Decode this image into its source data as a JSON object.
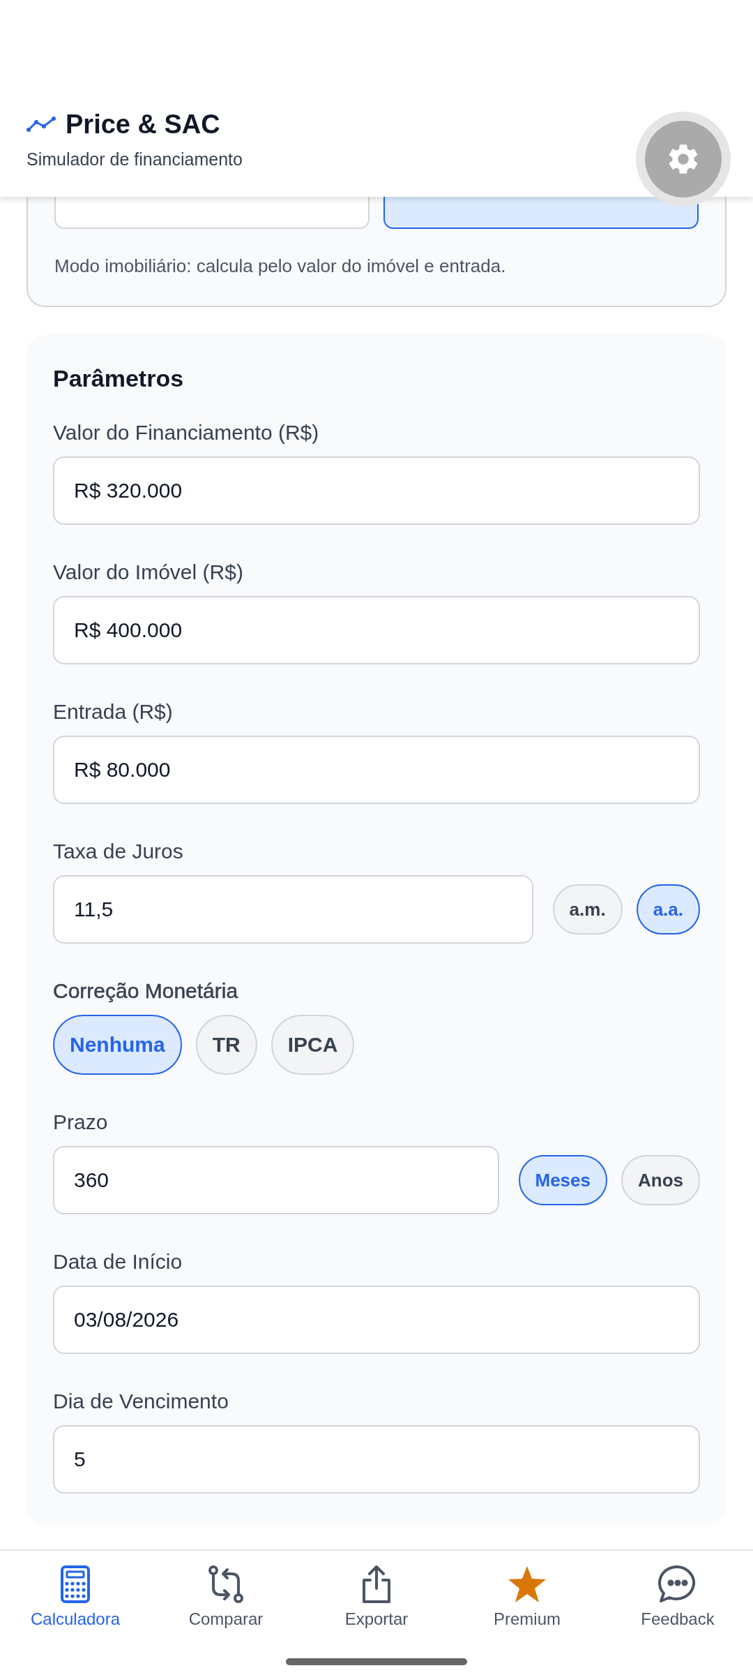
{
  "header": {
    "title": "Price & SAC",
    "subtitle": "Simulador de financiamento"
  },
  "mode": {
    "options": [
      {
        "selected": false
      },
      {
        "selected": true
      }
    ],
    "note": "Modo imobiliário: calcula pelo valor do imóvel e entrada."
  },
  "parameters": {
    "title": "Parâmetros",
    "fields": [
      {
        "kind": "input",
        "label": "Valor do Financiamento (R$)",
        "value": "R$ 320.000"
      },
      {
        "kind": "input",
        "label": "Valor do Imóvel (R$)",
        "value": "R$ 400.000"
      },
      {
        "kind": "input",
        "label": "Entrada (R$)",
        "value": "R$ 80.000"
      },
      {
        "kind": "input_units",
        "label": "Taxa de Juros",
        "value": "11,5",
        "units": [
          {
            "label": "a.m.",
            "selected": false
          },
          {
            "label": "a.a.",
            "selected": true
          }
        ]
      },
      {
        "kind": "chips",
        "label": "Correção Monetária",
        "options": [
          {
            "label": "Nenhuma",
            "selected": true
          },
          {
            "label": "TR",
            "selected": false
          },
          {
            "label": "IPCA",
            "selected": false
          }
        ]
      },
      {
        "kind": "input_units",
        "label": "Prazo",
        "value": "360",
        "units": [
          {
            "label": "Meses",
            "selected": true
          },
          {
            "label": "Anos",
            "selected": false
          }
        ]
      },
      {
        "kind": "input",
        "label": "Data de Início",
        "value": "03/08/2026"
      },
      {
        "kind": "input",
        "label": "Dia de Vencimento",
        "value": "5"
      }
    ]
  },
  "nav": [
    {
      "label": "Calculadora",
      "selected": true
    },
    {
      "label": "Comparar",
      "selected": false
    },
    {
      "label": "Exportar",
      "selected": false
    },
    {
      "label": "Premium",
      "selected": false
    },
    {
      "label": "Feedback",
      "selected": false
    }
  ]
}
